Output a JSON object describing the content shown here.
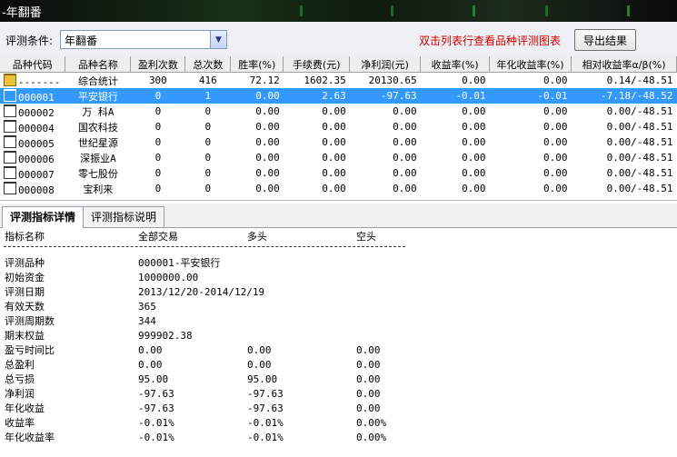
{
  "window": {
    "title": "-年翻番"
  },
  "toolbar": {
    "condition_label": "评测条件:",
    "condition_value": "年翻番",
    "hint": "双击列表行查看品种评测图表",
    "export_label": "导出结果"
  },
  "grid": {
    "columns": [
      "品种代码",
      "品种名称",
      "盈利次数",
      "总次数",
      "胜率(%)",
      "手续费(元)",
      "净利润(元)",
      "收益率(%)",
      "年化收益率(%)",
      "相对收益率α/β(%)"
    ],
    "rows": [
      {
        "code": "-------",
        "name": "综合统计",
        "wins": "300",
        "total": "416",
        "winrate": "72.12",
        "fee": "1602.35",
        "profit": "20130.65",
        "ret": "0.00",
        "annual": "0.00",
        "rel": "0.14/-48.51",
        "summary": true
      },
      {
        "code": "000001",
        "name": "平安银行",
        "wins": "0",
        "total": "1",
        "winrate": "0.00",
        "fee": "2.63",
        "profit": "-97.63",
        "ret": "-0.01",
        "annual": "-0.01",
        "rel": "-7.18/-48.52",
        "selected": true
      },
      {
        "code": "000002",
        "name": "万  科A",
        "wins": "0",
        "total": "0",
        "winrate": "0.00",
        "fee": "0.00",
        "profit": "0.00",
        "ret": "0.00",
        "annual": "0.00",
        "rel": "0.00/-48.51"
      },
      {
        "code": "000004",
        "name": "国农科技",
        "wins": "0",
        "total": "0",
        "winrate": "0.00",
        "fee": "0.00",
        "profit": "0.00",
        "ret": "0.00",
        "annual": "0.00",
        "rel": "0.00/-48.51"
      },
      {
        "code": "000005",
        "name": "世纪星源",
        "wins": "0",
        "total": "0",
        "winrate": "0.00",
        "fee": "0.00",
        "profit": "0.00",
        "ret": "0.00",
        "annual": "0.00",
        "rel": "0.00/-48.51"
      },
      {
        "code": "000006",
        "name": "深振业A",
        "wins": "0",
        "total": "0",
        "winrate": "0.00",
        "fee": "0.00",
        "profit": "0.00",
        "ret": "0.00",
        "annual": "0.00",
        "rel": "0.00/-48.51"
      },
      {
        "code": "000007",
        "name": "零七股份",
        "wins": "0",
        "total": "0",
        "winrate": "0.00",
        "fee": "0.00",
        "profit": "0.00",
        "ret": "0.00",
        "annual": "0.00",
        "rel": "0.00/-48.51"
      },
      {
        "code": "000008",
        "name": "宝利来",
        "wins": "0",
        "total": "0",
        "winrate": "0.00",
        "fee": "0.00",
        "profit": "0.00",
        "ret": "0.00",
        "annual": "0.00",
        "rel": "0.00/-48.51"
      }
    ]
  },
  "tabs": [
    {
      "label": "评测指标详情",
      "active": true
    },
    {
      "label": "评测指标说明",
      "active": false
    }
  ],
  "detail": {
    "headers": [
      "指标名称",
      "全部交易",
      "多头",
      "空头"
    ],
    "rows": [
      [
        "评测品种",
        "000001-平安银行",
        "",
        ""
      ],
      [
        "初始资金",
        "1000000.00",
        "",
        ""
      ],
      [
        "评测日期",
        "2013/12/20-2014/12/19",
        "",
        ""
      ],
      [
        "有效天数",
        "365",
        "",
        ""
      ],
      [
        "评测周期数",
        "344",
        "",
        ""
      ],
      [
        "期末权益",
        "999902.38",
        "",
        ""
      ],
      [
        "盈亏时间比",
        "0.00",
        "0.00",
        "0.00"
      ],
      [
        "总盈利",
        "0.00",
        "0.00",
        "0.00"
      ],
      [
        "总亏损",
        "95.00",
        "95.00",
        "0.00"
      ],
      [
        "净利润",
        "-97.63",
        "-97.63",
        "0.00"
      ],
      [
        "年化收益",
        "-97.63",
        "-97.63",
        "0.00"
      ],
      [
        "收益率",
        "-0.01%",
        "-0.01%",
        "0.00%"
      ],
      [
        "年化收益率",
        "-0.01%",
        "-0.01%",
        "0.00%"
      ]
    ]
  },
  "colors": {
    "selection": "#3399ff",
    "hint": "#d00000",
    "titlebar": "#163016"
  }
}
